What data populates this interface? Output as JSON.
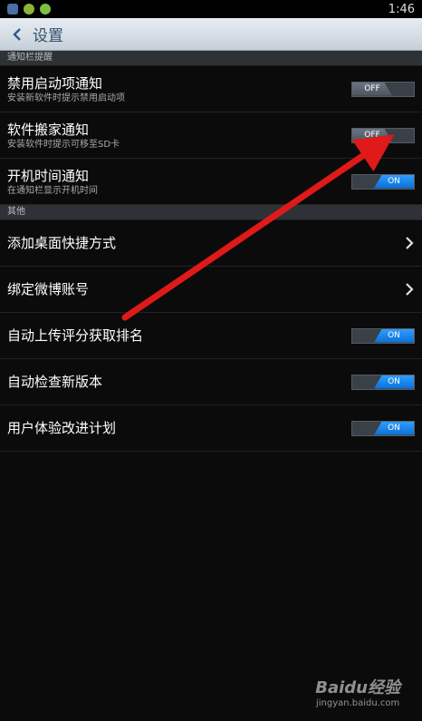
{
  "status_bar": {
    "time": "1:46",
    "icons": [
      "notification-icon",
      "app-icon",
      "android-icon"
    ]
  },
  "header": {
    "title": "设置",
    "back_icon": "chevron-left-icon"
  },
  "sections": [
    {
      "title": "通知栏提醒",
      "items": [
        {
          "title": "禁用启动项通知",
          "subtitle": "安装新软件时提示禁用启动项",
          "toggle": "OFF"
        },
        {
          "title": "软件搬家通知",
          "subtitle": "安装软件时提示可移至SD卡",
          "toggle": "OFF"
        },
        {
          "title": "开机时间通知",
          "subtitle": "在通知栏显示开机时间",
          "toggle": "ON"
        }
      ]
    },
    {
      "title": "其他",
      "items": [
        {
          "title": "添加桌面快捷方式",
          "chevron": true
        },
        {
          "title": "绑定微博账号",
          "chevron": true
        },
        {
          "title": "自动上传评分获取排名",
          "toggle": "ON"
        },
        {
          "title": "自动检查新版本",
          "toggle": "ON"
        },
        {
          "title": "用户体验改进计划",
          "toggle": "ON"
        }
      ]
    }
  ],
  "colors": {
    "accent_on": "#1a86f0",
    "header_bg": "#d6dde5",
    "annotation_arrow": "#e01919"
  },
  "watermark": {
    "logo": "Baidu经验",
    "url": "jingyan.baidu.com"
  }
}
